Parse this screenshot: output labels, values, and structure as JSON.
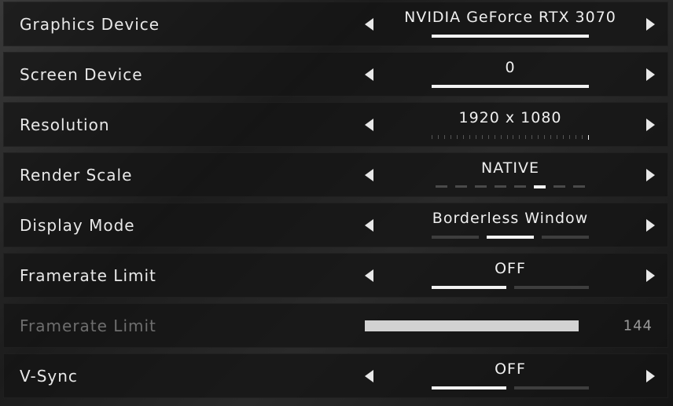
{
  "settings": [
    {
      "label": "Graphics Device",
      "value": "NVIDIA GeForce RTX 3070"
    },
    {
      "label": "Screen Device",
      "value": "0"
    },
    {
      "label": "Resolution",
      "value": "1920 x 1080"
    },
    {
      "label": "Render Scale",
      "value": "NATIVE",
      "selected_index": 5,
      "option_count": 8
    },
    {
      "label": "Display Mode",
      "value": "Borderless Window",
      "selected_index": 1,
      "option_count": 3
    },
    {
      "label": "Framerate Limit",
      "value": "OFF",
      "selected_index": 0,
      "option_count": 2
    },
    {
      "label": "Framerate Limit",
      "value": "144",
      "disabled": true
    },
    {
      "label": "V-Sync",
      "value": "OFF",
      "selected_index": 0,
      "option_count": 2
    }
  ],
  "colors": {
    "text": "#e8e8e8",
    "disabled_text": "#6e6e6e",
    "indicator_active": "#f2f2f2",
    "indicator_inactive": "#3e3e3e",
    "slider": "#d2d2d2"
  },
  "icons": {
    "prev": "triangle-left",
    "next": "triangle-right"
  }
}
